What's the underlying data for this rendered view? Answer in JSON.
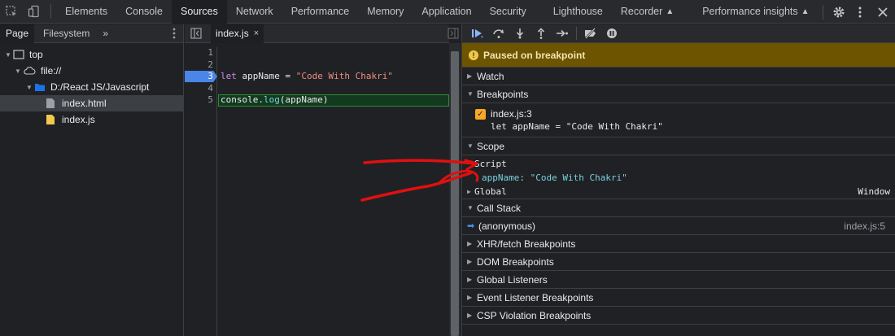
{
  "top_tabs": [
    "Elements",
    "Console",
    "Sources",
    "Network",
    "Performance",
    "Memory",
    "Application",
    "Security",
    "Lighthouse",
    "Recorder",
    "Performance insights"
  ],
  "active_tab": "Sources",
  "navigator": {
    "tabs": [
      "Page",
      "Filesystem"
    ],
    "more": "»",
    "tree": {
      "top": "top",
      "origin": "file://",
      "folder": "D:/React JS/Javascript",
      "file_html": "index.html",
      "file_js": "index.js"
    }
  },
  "editor": {
    "tab_label": "index.js",
    "close": "×",
    "line_numbers": [
      "1",
      "2",
      "3",
      "4",
      "5"
    ],
    "line3": {
      "kw": "let",
      "rest": " appName = ",
      "str": "\"Code With Chakri\""
    },
    "line5": {
      "obj": "console.",
      "fn": "log",
      "rest": "(appName)"
    }
  },
  "debugger": {
    "paused": "Paused on breakpoint",
    "sections": {
      "watch": "Watch",
      "breakpoints": "Breakpoints",
      "scope": "Scope",
      "call_stack": "Call Stack",
      "xhr": "XHR/fetch Breakpoints",
      "dom": "DOM Breakpoints",
      "global_listeners": "Global Listeners",
      "event_listener": "Event Listener Breakpoints",
      "csp": "CSP Violation Breakpoints"
    },
    "breakpoint": {
      "file": "index.js:3",
      "code": "let appName = \"Code With Chakri\""
    },
    "scope": {
      "script": "Script",
      "prop_name": "appName",
      "prop_value": "\"Code With Chakri\"",
      "global": "Global",
      "global_value": "Window"
    },
    "call_stack_frame": {
      "name": "(anonymous)",
      "location": "index.js:5"
    }
  },
  "colors": {
    "paused_bg": "#6d5400",
    "breakpoint_blue": "#4a86e8",
    "annotation_red": "#e01010"
  }
}
